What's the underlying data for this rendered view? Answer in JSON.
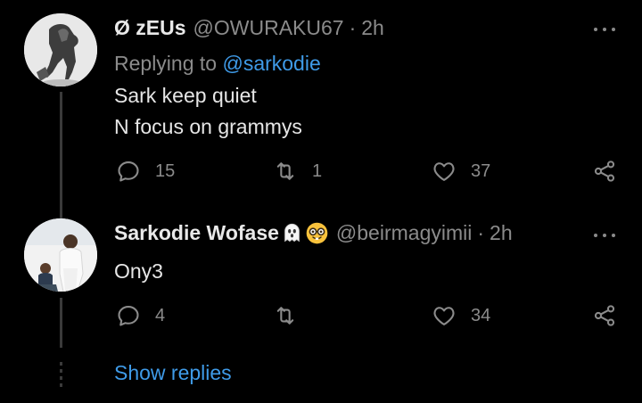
{
  "tweets": [
    {
      "name": "Ø zEUs",
      "handle": "@OWURAKU67",
      "separator": "·",
      "time": "2h",
      "replying_prefix": "Replying to ",
      "replying_to": "@sarkodie",
      "lines": [
        "Sark keep quiet",
        "N focus on grammys"
      ],
      "replies": "15",
      "retweets": "1",
      "likes": "37"
    },
    {
      "name": "Sarkodie Wofase",
      "emojis": [
        "ghost-emoji",
        "nerd-face-emoji"
      ],
      "handle": "@beirmagyimii",
      "separator": "·",
      "time": "2h",
      "lines": [
        "Ony3"
      ],
      "replies": "4",
      "retweets": "",
      "likes": "34"
    }
  ],
  "show_replies": "Show replies",
  "colors": {
    "background": "#000000",
    "text": "#e6e6e6",
    "muted": "#8b8b8b",
    "accent": "#3f9be8",
    "thread_line": "#3a3a3a"
  }
}
